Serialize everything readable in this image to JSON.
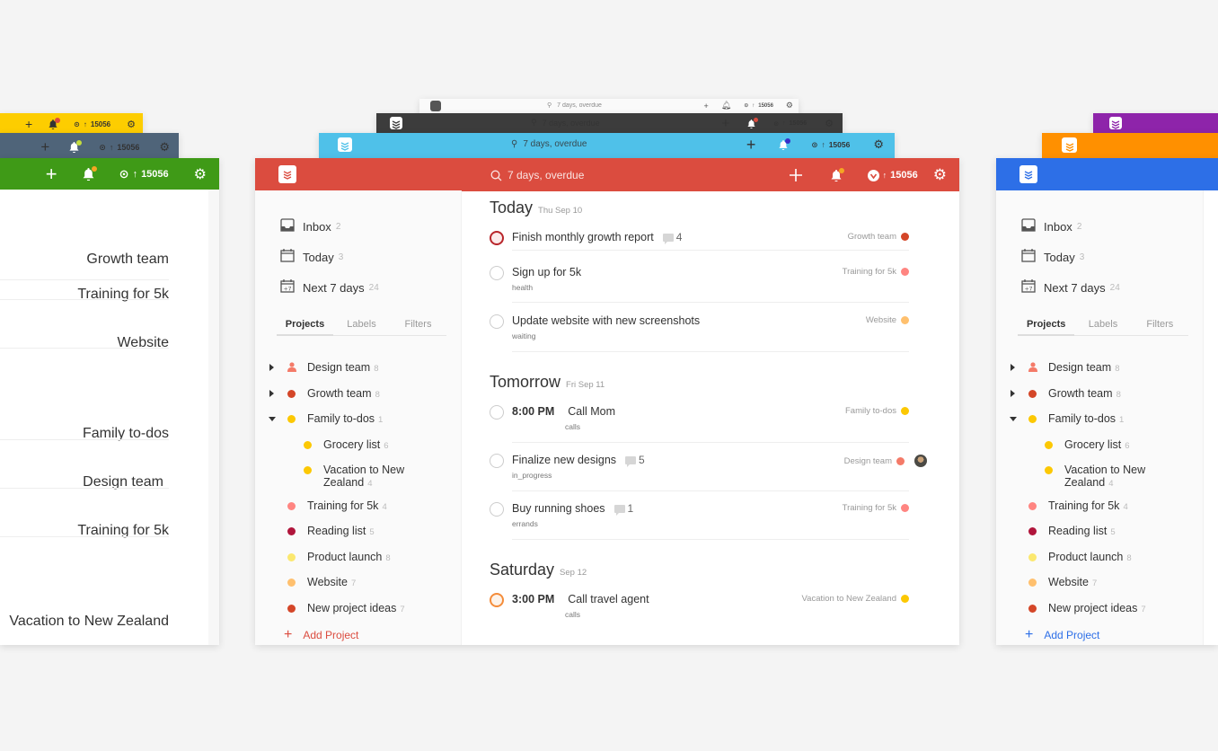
{
  "colors": {
    "red": "#db4c3f",
    "green": "#3f9a17",
    "slate": "#4f6479",
    "yellow": "#fdcd00",
    "cyan": "#4fc1e9",
    "dark": "#3c3c3c",
    "light": "#fafafa",
    "purple": "#8e24aa",
    "orange": "#ff9000",
    "blue": "#2d6fe7"
  },
  "header": {
    "search_placeholder": "7 days, overdue",
    "karma_score": "15056",
    "karma_arrow": "↑",
    "icons": [
      "logo-icon",
      "search-icon",
      "add-icon",
      "bell-icon",
      "karma-icon",
      "gear-icon"
    ]
  },
  "sidebar": {
    "nav": [
      {
        "label": "Inbox",
        "count": "2",
        "icon": "inbox-icon"
      },
      {
        "label": "Today",
        "count": "3",
        "icon": "calendar-icon"
      },
      {
        "label": "Next 7 days",
        "count": "24",
        "icon": "calendar-plus7-icon"
      }
    ],
    "tabs": [
      "Projects",
      "Labels",
      "Filters"
    ],
    "active_tab": "Projects",
    "projects": [
      {
        "name": "Design team",
        "count": "8",
        "color": "#f47a68",
        "shared": true,
        "arrow": "right"
      },
      {
        "name": "Growth team",
        "count": "8",
        "color": "#d44628",
        "arrow": "right"
      },
      {
        "name": "Family to-dos",
        "count": "1",
        "color": "#fcc803",
        "arrow": "down"
      },
      {
        "name": "Grocery list",
        "count": "6",
        "color": "#fcc803",
        "indent": 1
      },
      {
        "name": "Vacation to New Zealand",
        "name_line1": "Vacation to New",
        "name_line2": "Zealand",
        "count": "4",
        "color": "#fcc803",
        "indent": 1
      },
      {
        "name": "Training for 5k",
        "count": "4",
        "color": "#ff8581"
      },
      {
        "name": "Reading list",
        "count": "5",
        "color": "#b0153b"
      },
      {
        "name": "Product launch",
        "count": "8",
        "color": "#fbe86f"
      },
      {
        "name": "Website",
        "count": "7",
        "color": "#ffc06e"
      },
      {
        "name": "New project ideas",
        "count": "7",
        "color": "#d44628"
      }
    ],
    "add_project_label": "Add Project"
  },
  "main": {
    "sections": [
      {
        "title": "Today",
        "date": "Thu Sep 10",
        "tasks": [
          {
            "title": "Finish monthly growth report",
            "comments": "4",
            "project": "Growth team",
            "project_color": "#d44628",
            "priority": "p1"
          },
          {
            "title": "Sign up for 5k",
            "label": "health",
            "project": "Training for 5k",
            "project_color": "#ff8581"
          },
          {
            "title": "Update website with new screenshots",
            "label": "waiting",
            "project": "Website",
            "project_color": "#ffc06e"
          }
        ]
      },
      {
        "title": "Tomorrow",
        "date": "Fri Sep 11",
        "tasks": [
          {
            "time": "8:00 PM",
            "title": "Call Mom",
            "label": "calls",
            "project": "Family to-dos",
            "project_color": "#fcc803"
          },
          {
            "title": "Finalize new designs",
            "comments": "5",
            "label": "in_progress",
            "project": "Design team",
            "project_color": "#f47a68",
            "assignee": "avatar"
          },
          {
            "title": "Buy running shoes",
            "comments": "1",
            "label": "errands",
            "project": "Training for 5k",
            "project_color": "#ff8581"
          }
        ]
      },
      {
        "title": "Saturday",
        "date": "Sep 12",
        "tasks": [
          {
            "time": "3:00 PM",
            "title": "Call travel agent",
            "label": "calls",
            "project": "Vacation to New Zealand",
            "project_color": "#fcc803",
            "priority": "p3"
          }
        ]
      }
    ]
  },
  "left_window": {
    "tags": [
      {
        "project": "Growth team",
        "color": "#d44628"
      },
      {
        "project": "Training for 5k",
        "color": "#ff8581"
      },
      {
        "project": "Website",
        "color": "#ffc06e"
      },
      {
        "project": "Family to-dos",
        "color": "#fcc803"
      },
      {
        "project": "Design team",
        "color": "#f47a68",
        "assignee": "avatar"
      },
      {
        "project": "Training for 5k",
        "color": "#ff8581"
      },
      {
        "project": "Vacation to New Zealand",
        "color": "#fcc803"
      }
    ]
  }
}
